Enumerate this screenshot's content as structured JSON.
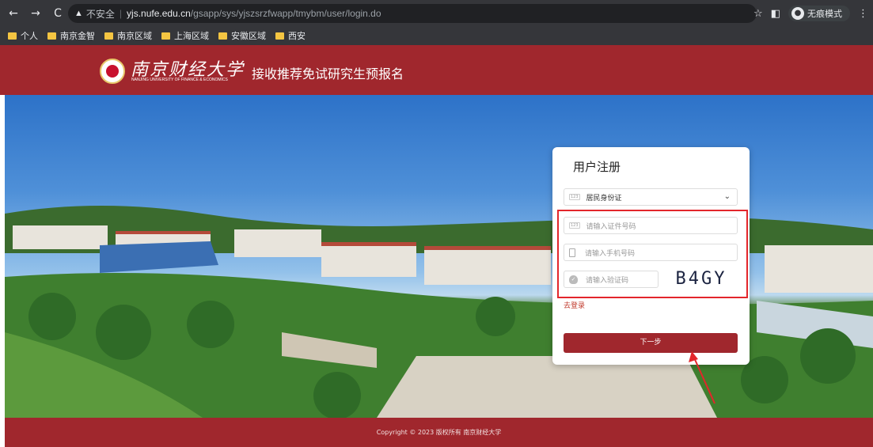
{
  "browser": {
    "nav": {
      "back": "←",
      "forward": "→",
      "reload": "C"
    },
    "url": {
      "warning_icon": "▲",
      "insecure_label": "不安全",
      "separator": "|",
      "host": "yjs.nufe.edu.cn",
      "path": "/gsapp/sys/yjszsrzfwapp/tmybm/user/login.do"
    },
    "incognito_label": "无痕模式",
    "bookmarks": [
      "个人",
      "南京金智",
      "南京区域",
      "上海区域",
      "安徽区域",
      "西安"
    ]
  },
  "site": {
    "logo_cn": "南京财经大学",
    "logo_en": "NANJING UNIVERSITY OF FINANCE & ECONOMICS",
    "title": "接收推荐免试研究生预报名"
  },
  "form": {
    "title": "用户注册",
    "id_type_badge": "123",
    "id_type_value": "居民身份证",
    "id_number_badge": "123",
    "id_number_placeholder": "请输入证件号码",
    "phone_placeholder": "请输入手机号码",
    "captcha_placeholder": "请输入验证码",
    "captcha_text": "B4GY",
    "login_link": "去登录",
    "next_button": "下一步"
  },
  "footer": {
    "copyright": "Copyright © 2023 版权所有 南京财经大学"
  },
  "colors": {
    "brand_red": "#a0272d",
    "highlight_red": "#e3262b"
  }
}
